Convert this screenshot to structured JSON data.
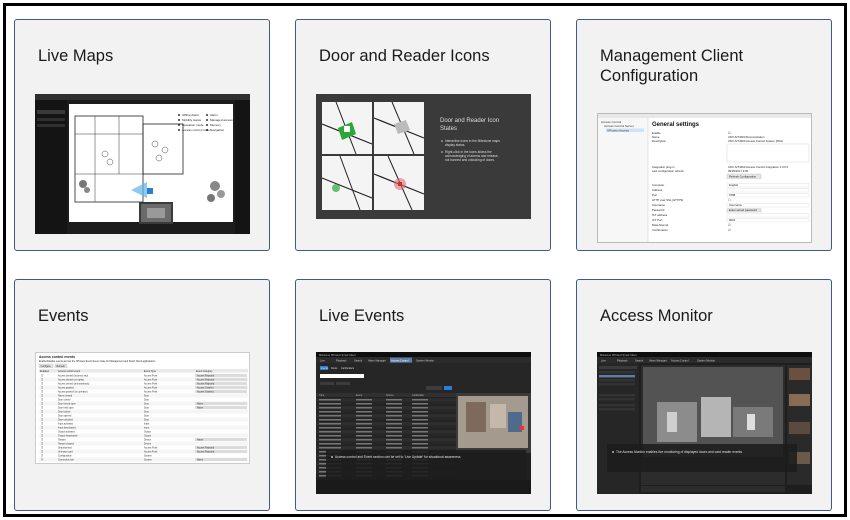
{
  "cards": [
    {
      "id": "live-maps",
      "title": "Live Maps",
      "legend": [
        "Offline Alarm",
        "Mobility status",
        "Operation mode",
        "Access control mode",
        "Alarm",
        "Managed access",
        "Memory",
        "Navigation"
      ]
    },
    {
      "id": "door-reader-icons",
      "title": "Door and Reader Icons",
      "heading": "Door and Reader Icon States",
      "bullets": [
        "Interactive icons in the Milestone maps display status.",
        "Right-click in the icons allows the acknowledging of alarms and release, not banned and unlocking of doors."
      ]
    },
    {
      "id": "management-client",
      "title": "Management Client Configuration",
      "section": "General settings",
      "tree": [
        "Access Control",
        "Access Control Server",
        "XProtect Access"
      ],
      "fields": [
        {
          "label": "Enable",
          "value": "☑"
        },
        {
          "label": "Name",
          "value": "CDX-S/T4000 Demonstration"
        },
        {
          "label": "Description",
          "value": "CDX-S/T4000 Access Control System (Pilot)"
        },
        {
          "label": "Integration plug-in",
          "value": "CDX-S/T4000 Access Control Integration 1.0.0.0"
        },
        {
          "label": "Last configuration refresh",
          "value": "09/09/2017 9:00"
        },
        {
          "label": "",
          "value": "Refresh Configuration"
        },
        {
          "label": "Computer",
          "value": "English"
        },
        {
          "label": "Address",
          "value": ""
        },
        {
          "label": "Port",
          "value": "9788"
        },
        {
          "label": "HTTP over SSL (HTTPS)",
          "value": ""
        },
        {
          "label": "Username",
          "value": "Username"
        },
        {
          "label": "Password",
          "value": "Enter stored password"
        },
        {
          "label": "ICT address",
          "value": ""
        },
        {
          "label": "ICT Port",
          "value": "9001"
        },
        {
          "label": "Data Attempt",
          "value": "☑"
        },
        {
          "label": "Confirmation",
          "value": "☑"
        }
      ]
    },
    {
      "id": "events",
      "title": "Events",
      "heading": "Access control events",
      "subtitle": "Enable/Disable events and set the XProtect Event Server state for Management and Smart Client applications",
      "toolbar": [
        "Configure",
        "Refresh"
      ],
      "columns": [
        "Enabled",
        "Access control event",
        "Event Type",
        "Event Category"
      ],
      "rows": [
        [
          "☑",
          "Access denied (incorrect key)",
          "Access Point",
          "Access Rejected"
        ],
        [
          "☑",
          "Access denied (no rights)",
          "Access Point",
          "Access Rejected"
        ],
        [
          "☑",
          "Access denied (anti-passback)",
          "Access Point",
          "Access Rejected"
        ],
        [
          "☑",
          "Access granted",
          "Access Point",
          "Access Granted"
        ],
        [
          "☑",
          "Access granted (by operator)",
          "Access Point",
          "Access Granted"
        ],
        [
          "☑",
          "Alarm cleared",
          "Door",
          ""
        ],
        [
          "☑",
          "Door closed",
          "Door",
          ""
        ],
        [
          "☑",
          "Door forced open",
          "Door",
          "Alarm"
        ],
        [
          "☑",
          "Door held open",
          "Door",
          "Alarm"
        ],
        [
          "☑",
          "Door locked",
          "Door",
          ""
        ],
        [
          "☑",
          "Door opened",
          "Door",
          ""
        ],
        [
          "☑",
          "Door unlocked",
          "Door",
          ""
        ],
        [
          "☑",
          "Input activated",
          "Input",
          ""
        ],
        [
          "☑",
          "Input deactivated",
          "Input",
          ""
        ],
        [
          "☑",
          "Output activated",
          "Output",
          ""
        ],
        [
          "☑",
          "Output deactivated",
          "Output",
          ""
        ],
        [
          "☑",
          "Tamper",
          "Device",
          "Alarm"
        ],
        [
          "☑",
          "Tamper cleared",
          "Device",
          ""
        ],
        [
          "☑",
          "Unauthorized",
          "Access Point",
          "Access Rejected"
        ],
        [
          "☑",
          "Unknown card",
          "Access Point",
          "Access Rejected"
        ],
        [
          "☑",
          "Configuration",
          "System",
          ""
        ],
        [
          "☑",
          "Connection lost",
          "System",
          "Alarm"
        ]
      ]
    },
    {
      "id": "live-events",
      "title": "Live Events",
      "appname": "Milestone XProtect Smart Client",
      "tabs": [
        "Live",
        "Playback",
        "Search",
        "Alarm Manager",
        "Access Control",
        "System Monitor"
      ],
      "active_tab": "Access Control",
      "subtabs": [
        "Events",
        "Doors",
        "Cardholders"
      ],
      "columns": [
        "Time",
        "Event",
        "Source",
        "Cardholder"
      ],
      "caption": "Access control and Event section can be set to 'Live Update' for situational awareness"
    },
    {
      "id": "access-monitor",
      "title": "Access Monitor",
      "appname": "Milestone XProtect Smart Client",
      "tabs": [
        "Live",
        "Playback",
        "Search",
        "Alarm Manager",
        "Access Control",
        "System Monitor"
      ],
      "caption": "The Access Monitor enables live monitoring of displayed doors and card reader events"
    }
  ],
  "colors": {
    "card_border": "#3f5a85",
    "card_bg": "#f2f2f2",
    "dark_ui": "#1b1b1b",
    "accent_green": "#2aa838",
    "accent_red": "#c0392b",
    "accent_blue": "#2a7fd4"
  }
}
